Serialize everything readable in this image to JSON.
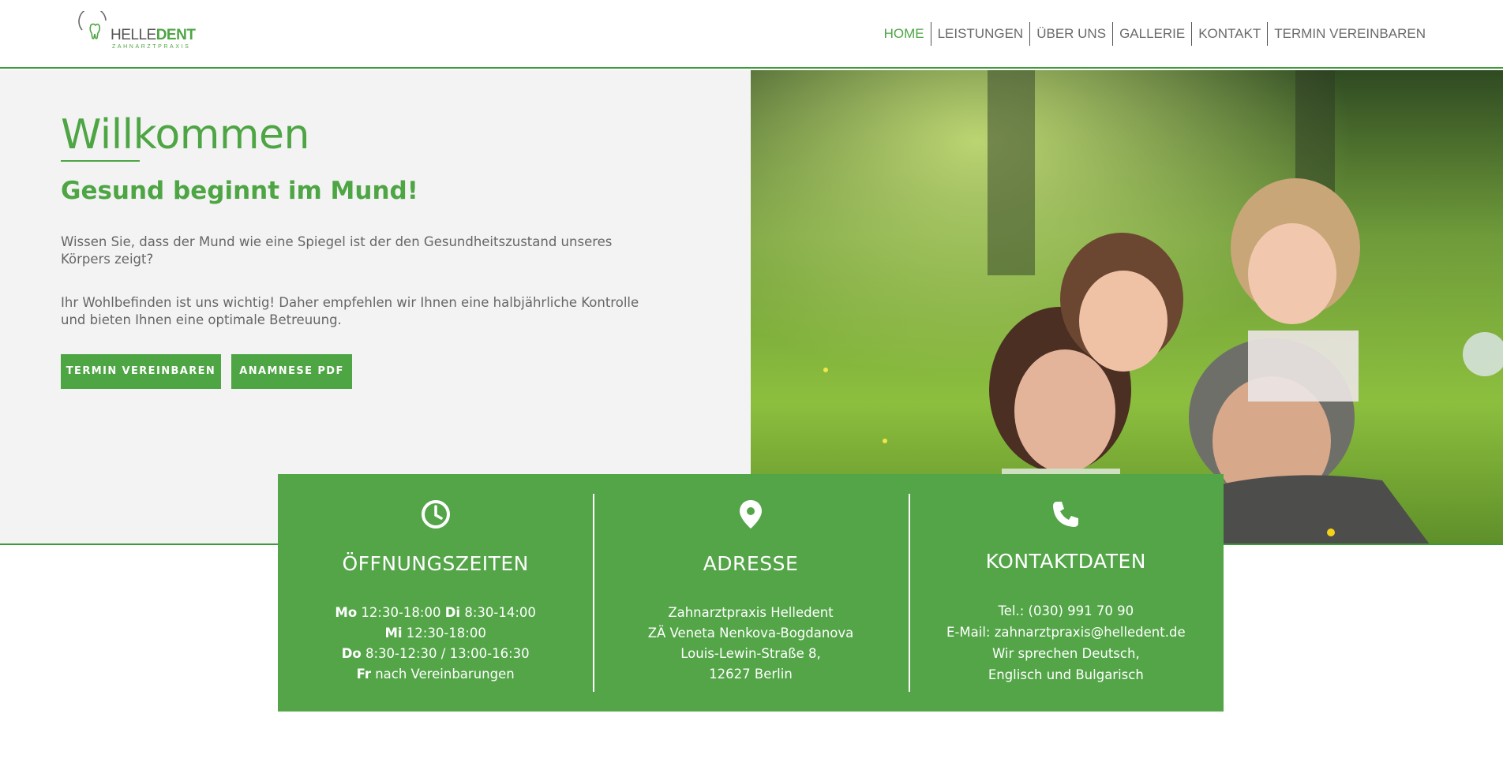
{
  "brand": {
    "name_part1": "HELLE",
    "name_part2": "DENT",
    "tagline": "ZAHNARZTPRAXIS",
    "accent_color": "#4ea544"
  },
  "nav": {
    "items": [
      {
        "label": "HOME",
        "active": true
      },
      {
        "label": "LEISTUNGEN",
        "active": false
      },
      {
        "label": "ÜBER UNS",
        "active": false
      },
      {
        "label": "GALLERIE",
        "active": false
      },
      {
        "label": "KONTAKT",
        "active": false
      },
      {
        "label": "TERMIN VEREINBAREN",
        "active": false
      }
    ]
  },
  "hero": {
    "title": "Willkommen",
    "subtitle": "Gesund beginnt im Mund!",
    "paragraph1": "Wissen Sie, dass der Mund wie eine Spiegel ist der den Gesundheitszustand unseres Körpers zeigt?",
    "paragraph2": "Ihr Wohlbefinden ist uns wichtig! Daher empfehlen wir Ihnen eine halbjährliche Kontrolle und bieten Ihnen eine optimale Betreuung.",
    "button_appointment": "TERMIN VEREINBAREN",
    "button_pdf": "ANAMNESE PDF",
    "image_icon": "family-photo"
  },
  "info": {
    "hours": {
      "icon": "clock-icon",
      "title": "ÖFFNUNGSZEITEN",
      "mo_day": "Mo",
      "mo_time": " 12:30-18:00 ",
      "di_day": "Di",
      "di_time": " 8:30-14:00",
      "mi_day": "Mi",
      "mi_time": " 12:30-18:00",
      "do_day": "Do",
      "do_time": " 8:30-12:30 / 13:00-16:30",
      "fr_day": "Fr",
      "fr_time": " nach Vereinbarungen"
    },
    "address": {
      "icon": "map-pin-icon",
      "title": "ADRESSE",
      "line1": "Zahnarztpraxis Helledent",
      "line2": "ZÄ Veneta Nenkova-Bogdanova",
      "line3": "Louis-Lewin-Straße 8,",
      "line4": "12627 Berlin"
    },
    "contact": {
      "icon": "phone-icon",
      "title": "KONTAKTDATEN",
      "line1": "Tel.: (030) 991 70 90",
      "line2": "E-Mail: zahnarztpraxis@helledent.de",
      "line3": "Wir sprechen Deutsch,",
      "line4": "Englisch und Bulgarisch"
    }
  }
}
